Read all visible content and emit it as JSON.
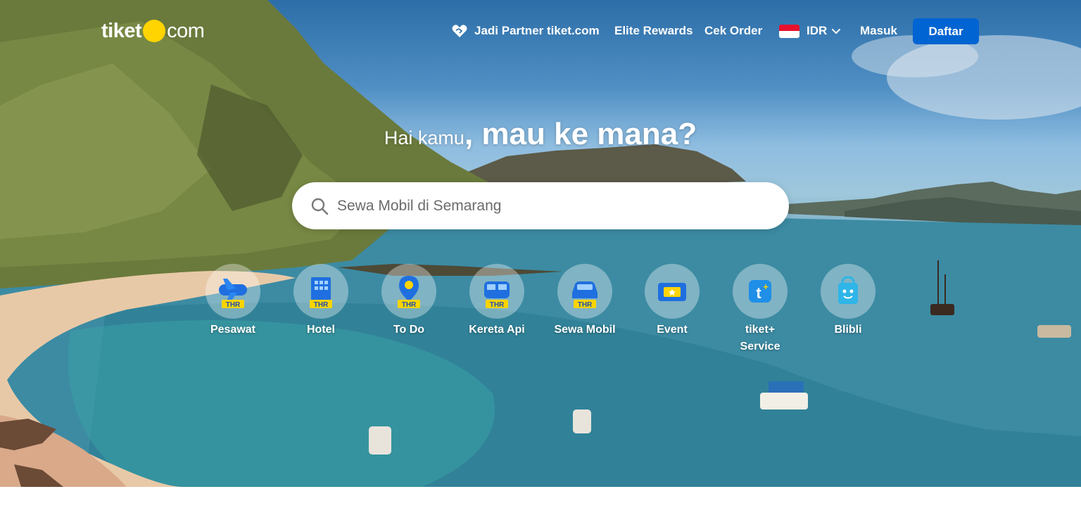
{
  "brand": {
    "logo_left": "tiket",
    "logo_right": "com",
    "accent_yellow": "#ffd400",
    "primary_blue": "#0064d2"
  },
  "nav": {
    "partner_label": "Jadi Partner tiket.com",
    "partner_icon": "handshake-heart-icon",
    "elite_label": "Elite Rewards",
    "order_label": "Cek Order",
    "currency_label": "IDR",
    "currency_flag": "indonesia-flag-icon",
    "login_label": "Masuk",
    "register_label": "Daftar"
  },
  "hero": {
    "greeting": "Hai kamu",
    "question": ", mau ke mana?"
  },
  "search": {
    "placeholder": "Sewa Mobil di Semarang",
    "icon": "search-icon"
  },
  "categories": [
    {
      "label": "Pesawat",
      "icon": "airplane-icon",
      "badge": "THR"
    },
    {
      "label": "Hotel",
      "icon": "hotel-icon",
      "badge": "THR"
    },
    {
      "label": "To Do",
      "icon": "location-pin-icon",
      "badge": "THR"
    },
    {
      "label": "Kereta Api",
      "icon": "train-icon",
      "badge": "THR"
    },
    {
      "label": "Sewa Mobil",
      "icon": "car-icon",
      "badge": "THR"
    },
    {
      "label": "Event",
      "icon": "ticket-icon",
      "badge": ""
    },
    {
      "label": "tiket+ Service",
      "icon": "tiket-plus-icon",
      "badge": ""
    },
    {
      "label": "Blibli",
      "icon": "blibli-bag-icon",
      "badge": ""
    }
  ]
}
